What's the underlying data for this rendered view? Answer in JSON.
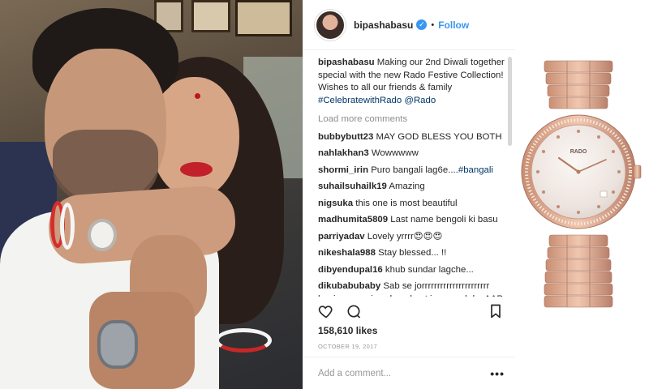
{
  "header": {
    "username": "bipashabasu",
    "separator": "•",
    "follow_label": "Follow"
  },
  "caption": {
    "username": "bipashabasu",
    "text": " Making our 2nd Diwali together special with the new Rado Festive Collection! Wishes to all our friends & family ",
    "hashtag": "#CelebratewithRado",
    "mention": " @Rado"
  },
  "load_more": "Load more comments",
  "comments": [
    {
      "user": "bubbybutt23",
      "text": " MAY GOD BLESS YOU BOTH"
    },
    {
      "user": "nahlakhan3",
      "text": " Wowwwww"
    },
    {
      "user": "shormi_irin",
      "text": " Puro bangali lag6e....",
      "tag": "#bangali"
    },
    {
      "user": "suhailsuhailk19",
      "text": " Amazing"
    },
    {
      "user": "nigsuka",
      "text": " this one is most beautiful"
    },
    {
      "user": "madhumita5809",
      "text": " Last name bengoli ki basu"
    },
    {
      "user": "parriyadav",
      "text": " Lovely yrrrr😍😍😍"
    },
    {
      "user": "nikeshala988",
      "text": " Stay blessed... !!"
    },
    {
      "user": "dibyendupal16",
      "text": " khub sundar lagche..."
    },
    {
      "user": "dikubabubaby",
      "text": " Sab se jorrrrrrrrrrrrrrrrrrrrrr henjeee ye pic sab se best jeeee sab ko AAP DONO KI JODI HAMESHA BANAYE"
    }
  ],
  "actions": {
    "like_icon": "heart-icon",
    "comment_icon": "comment-icon",
    "save_icon": "bookmark-icon"
  },
  "likes": "158,610 likes",
  "date": "OCTOBER 19, 2017",
  "add_comment": {
    "placeholder": "Add a comment...",
    "more_label": "•••"
  },
  "watch": {
    "brand": "RADO"
  },
  "colors": {
    "link": "#3897f0",
    "hashtag": "#003569",
    "muted": "#8e8e8e",
    "rose_gold": "#d9a48a"
  }
}
